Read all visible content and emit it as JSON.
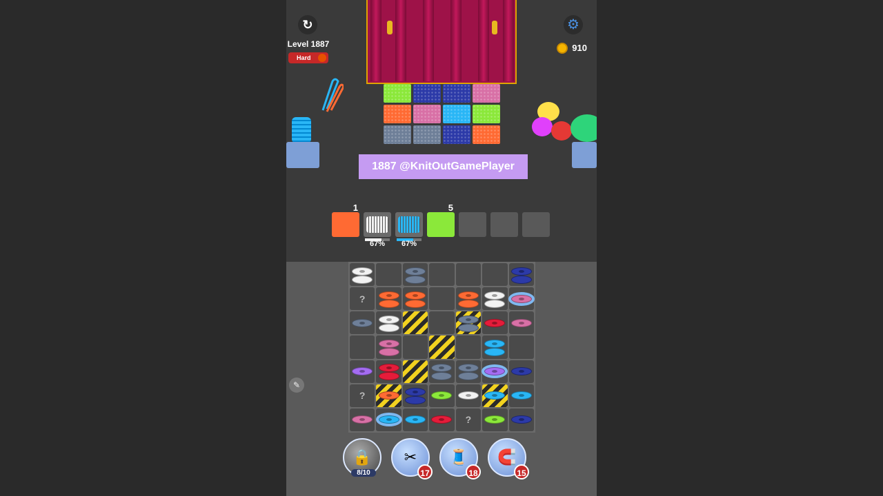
{
  "colors": {
    "orange": "#ff6a33",
    "white": "#f2f2f2",
    "cyan": "#29b6f6",
    "lime": "#8be83a",
    "navy": "#2c3aa8",
    "pink": "#d870a6",
    "gray": "#6e7f98",
    "red": "#e51c3a",
    "purple": "#a46cf2",
    "ice": "#7fb8f0"
  },
  "header": {
    "level_label": "Level 1887",
    "difficulty": "Hard",
    "coins": "910",
    "restart_icon": "restart-icon",
    "settings_icon": "gear-icon"
  },
  "patches": [
    "#8be83a",
    "#2c3aa8",
    "#2c3aa8",
    "#d870a6",
    "#ff6a33",
    "#d870a6",
    "#29b6f6",
    "#8be83a",
    "#6e7f98",
    "#6e7f98",
    "#2c3aa8",
    "#ff6a33"
  ],
  "banner_text": "1887 @KnitOutGamePlayer",
  "slots": [
    {
      "kind": "patch",
      "color": "#ff6a33",
      "number": "1",
      "percent": ""
    },
    {
      "kind": "spool",
      "color": "#f2f2f2",
      "number": "",
      "percent": "67%",
      "progress": 0.67
    },
    {
      "kind": "spool",
      "color": "#29b6f6",
      "number": "",
      "percent": "67%",
      "progress": 0.67
    },
    {
      "kind": "patch",
      "color": "#8be83a",
      "number": "5",
      "percent": ""
    },
    {
      "kind": "empty",
      "color": "",
      "number": "",
      "percent": ""
    },
    {
      "kind": "empty",
      "color": "",
      "number": "",
      "percent": ""
    },
    {
      "kind": "empty",
      "color": "",
      "number": "",
      "percent": ""
    }
  ],
  "board": [
    [
      {
        "s": [
          "white",
          "white"
        ]
      },
      {
        "s": []
      },
      {
        "s": [
          "gray",
          "gray"
        ]
      },
      {
        "s": []
      },
      {
        "s": []
      },
      {
        "s": []
      },
      {
        "s": [
          "navy",
          "navy"
        ]
      }
    ],
    [
      {
        "q": true
      },
      {
        "s": [
          "orange",
          "orange"
        ]
      },
      {
        "s": [
          "orange",
          "orange"
        ]
      },
      {
        "s": []
      },
      {
        "s": [
          "orange",
          "orange"
        ]
      },
      {
        "s": [
          "white",
          "white"
        ]
      },
      {
        "s": [
          "pink"
        ],
        "ice": true
      }
    ],
    [
      {
        "s": [
          "gray"
        ]
      },
      {
        "s": [
          "white",
          "white"
        ]
      },
      {
        "hatch": true
      },
      {
        "s": []
      },
      {
        "s": [
          "gray",
          "gray"
        ],
        "hatch": true
      },
      {
        "s": [
          "red"
        ]
      },
      {
        "s": [
          "pink"
        ]
      }
    ],
    [
      {
        "s": []
      },
      {
        "s": [
          "pink",
          "pink"
        ]
      },
      {
        "s": []
      },
      {
        "hatch": true
      },
      {
        "s": []
      },
      {
        "s": [
          "cyan",
          "cyan"
        ]
      },
      {
        "s": []
      }
    ],
    [
      {
        "s": [
          "purple"
        ]
      },
      {
        "s": [
          "red",
          "red"
        ]
      },
      {
        "hatch": true
      },
      {
        "s": [
          "gray",
          "gray"
        ]
      },
      {
        "s": [
          "gray",
          "gray"
        ]
      },
      {
        "s": [
          "purple"
        ],
        "ice": true
      },
      {
        "s": [
          "navy"
        ]
      }
    ],
    [
      {
        "q": true
      },
      {
        "s": [
          "orange"
        ],
        "hatch": true
      },
      {
        "s": [
          "navy",
          "navy"
        ]
      },
      {
        "s": [
          "lime"
        ]
      },
      {
        "s": [
          "white"
        ]
      },
      {
        "s": [
          "cyan"
        ],
        "hatch": true
      },
      {
        "s": [
          "cyan"
        ]
      }
    ],
    [
      {
        "s": [
          "pink"
        ]
      },
      {
        "s": [
          "cyan"
        ],
        "ice": true
      },
      {
        "s": [
          "cyan"
        ]
      },
      {
        "s": [
          "red"
        ]
      },
      {
        "q": true
      },
      {
        "s": [
          "lime"
        ]
      },
      {
        "s": [
          "navy"
        ]
      }
    ]
  ],
  "powerups": [
    {
      "name": "yarn-ball-icon",
      "count": "8/10",
      "locked": true,
      "badge": ""
    },
    {
      "name": "scissors-icon",
      "count": "",
      "locked": false,
      "badge": "17"
    },
    {
      "name": "thread-spool-icon",
      "count": "",
      "locked": false,
      "badge": "18"
    },
    {
      "name": "magnet-icon",
      "count": "",
      "locked": false,
      "badge": "15"
    }
  ]
}
